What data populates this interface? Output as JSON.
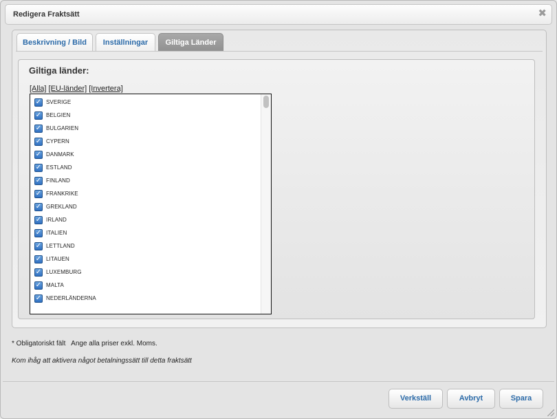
{
  "dialog": {
    "title": "Redigera Fraktsätt",
    "close_icon": "✖"
  },
  "tabs": [
    {
      "label": "Beskrivning / Bild",
      "active": false
    },
    {
      "label": "Inställningar",
      "active": false
    },
    {
      "label": "Giltiga Länder",
      "active": true
    }
  ],
  "section": {
    "heading": "Giltiga länder:",
    "link_all": "[Alla]",
    "link_eu": "[EU-länder]",
    "link_invert": "[Invertera]"
  },
  "countries": [
    {
      "name": "SVERIGE",
      "checked": true
    },
    {
      "name": "BELGIEN",
      "checked": true
    },
    {
      "name": "BULGARIEN",
      "checked": true
    },
    {
      "name": "CYPERN",
      "checked": true
    },
    {
      "name": "DANMARK",
      "checked": true
    },
    {
      "name": "ESTLAND",
      "checked": true
    },
    {
      "name": "FINLAND",
      "checked": true
    },
    {
      "name": "FRANKRIKE",
      "checked": true
    },
    {
      "name": "GREKLAND",
      "checked": true
    },
    {
      "name": "IRLAND",
      "checked": true
    },
    {
      "name": "ITALIEN",
      "checked": true
    },
    {
      "name": "LETTLAND",
      "checked": true
    },
    {
      "name": "LITAUEN",
      "checked": true
    },
    {
      "name": "LUXEMBURG",
      "checked": true
    },
    {
      "name": "MALTA",
      "checked": true
    },
    {
      "name": "NEDERLÄNDERNA",
      "checked": true
    }
  ],
  "notes": {
    "required": "* Obligatoriskt fält   Ange alla priser exkl. Moms.",
    "reminder": "Kom ihåg att aktivera något betalningssätt till detta fraktsätt"
  },
  "buttons": {
    "apply": "Verkställ",
    "cancel": "Avbryt",
    "save": "Spara"
  },
  "colors": {
    "link_blue": "#2b6aa8",
    "active_tab": "#999999",
    "checkbox": "#2f70c2"
  }
}
